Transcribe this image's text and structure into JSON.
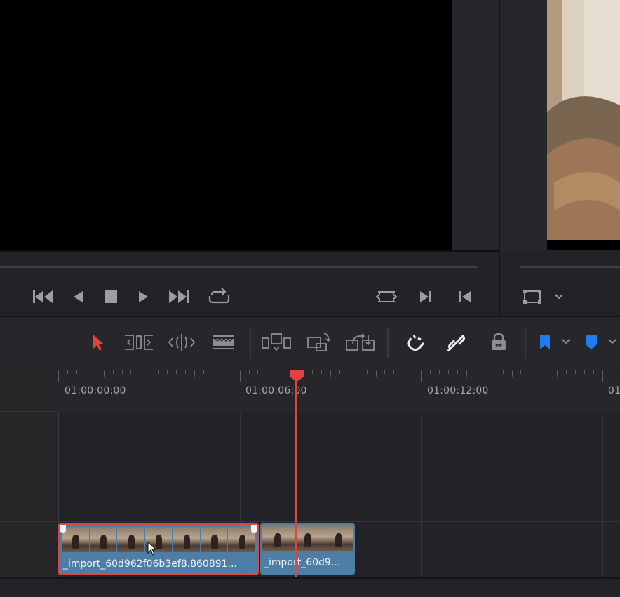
{
  "viewer": {
    "transport": {
      "first_frame": "skip-to-start-icon",
      "reverse": "play-reverse-icon",
      "stop": "stop-icon",
      "play": "play-icon",
      "last_frame": "skip-to-end-icon",
      "loop": "loop-icon",
      "match_frame": "match-frame-icon",
      "next_edit": "next-edit-icon",
      "prev_edit": "previous-edit-icon",
      "view_options": "transform-box-icon"
    }
  },
  "toolbar": {
    "tools": [
      {
        "name": "selection-mode",
        "icon": "arrow-pointer-icon",
        "active": true
      },
      {
        "name": "trim-edit-mode",
        "icon": "trim-icon"
      },
      {
        "name": "dynamic-trim-mode",
        "icon": "dynamic-trim-icon"
      },
      {
        "name": "blade-edit-mode",
        "icon": "blade-icon"
      },
      {
        "name": "insert-clip",
        "icon": "insert-icon"
      },
      {
        "name": "overwrite-clip",
        "icon": "overwrite-icon"
      },
      {
        "name": "replace-clip",
        "icon": "replace-icon"
      },
      {
        "name": "snapping",
        "icon": "magnet-icon",
        "active": true
      },
      {
        "name": "linked-selection",
        "icon": "link-icon",
        "active": true
      },
      {
        "name": "position-lock",
        "icon": "lock-icon"
      },
      {
        "name": "flag",
        "icon": "flag-icon",
        "color": "#1e7bf0"
      },
      {
        "name": "marker",
        "icon": "marker-icon",
        "color": "#1e7bf0"
      }
    ]
  },
  "timeline": {
    "ruler_labels": [
      "01:00:00:00",
      "01:00:06:00",
      "01:00:12:00",
      "01"
    ],
    "playhead_color": "#e0443b",
    "clips": [
      {
        "label": "_import_60d962f06b3ef8.860891...",
        "selected": true
      },
      {
        "label": "_import_60d9..."
      }
    ]
  },
  "colors": {
    "accent": "#e0443b",
    "clip_blue": "#4e7ea6",
    "flag_blue": "#1e7bf0"
  }
}
